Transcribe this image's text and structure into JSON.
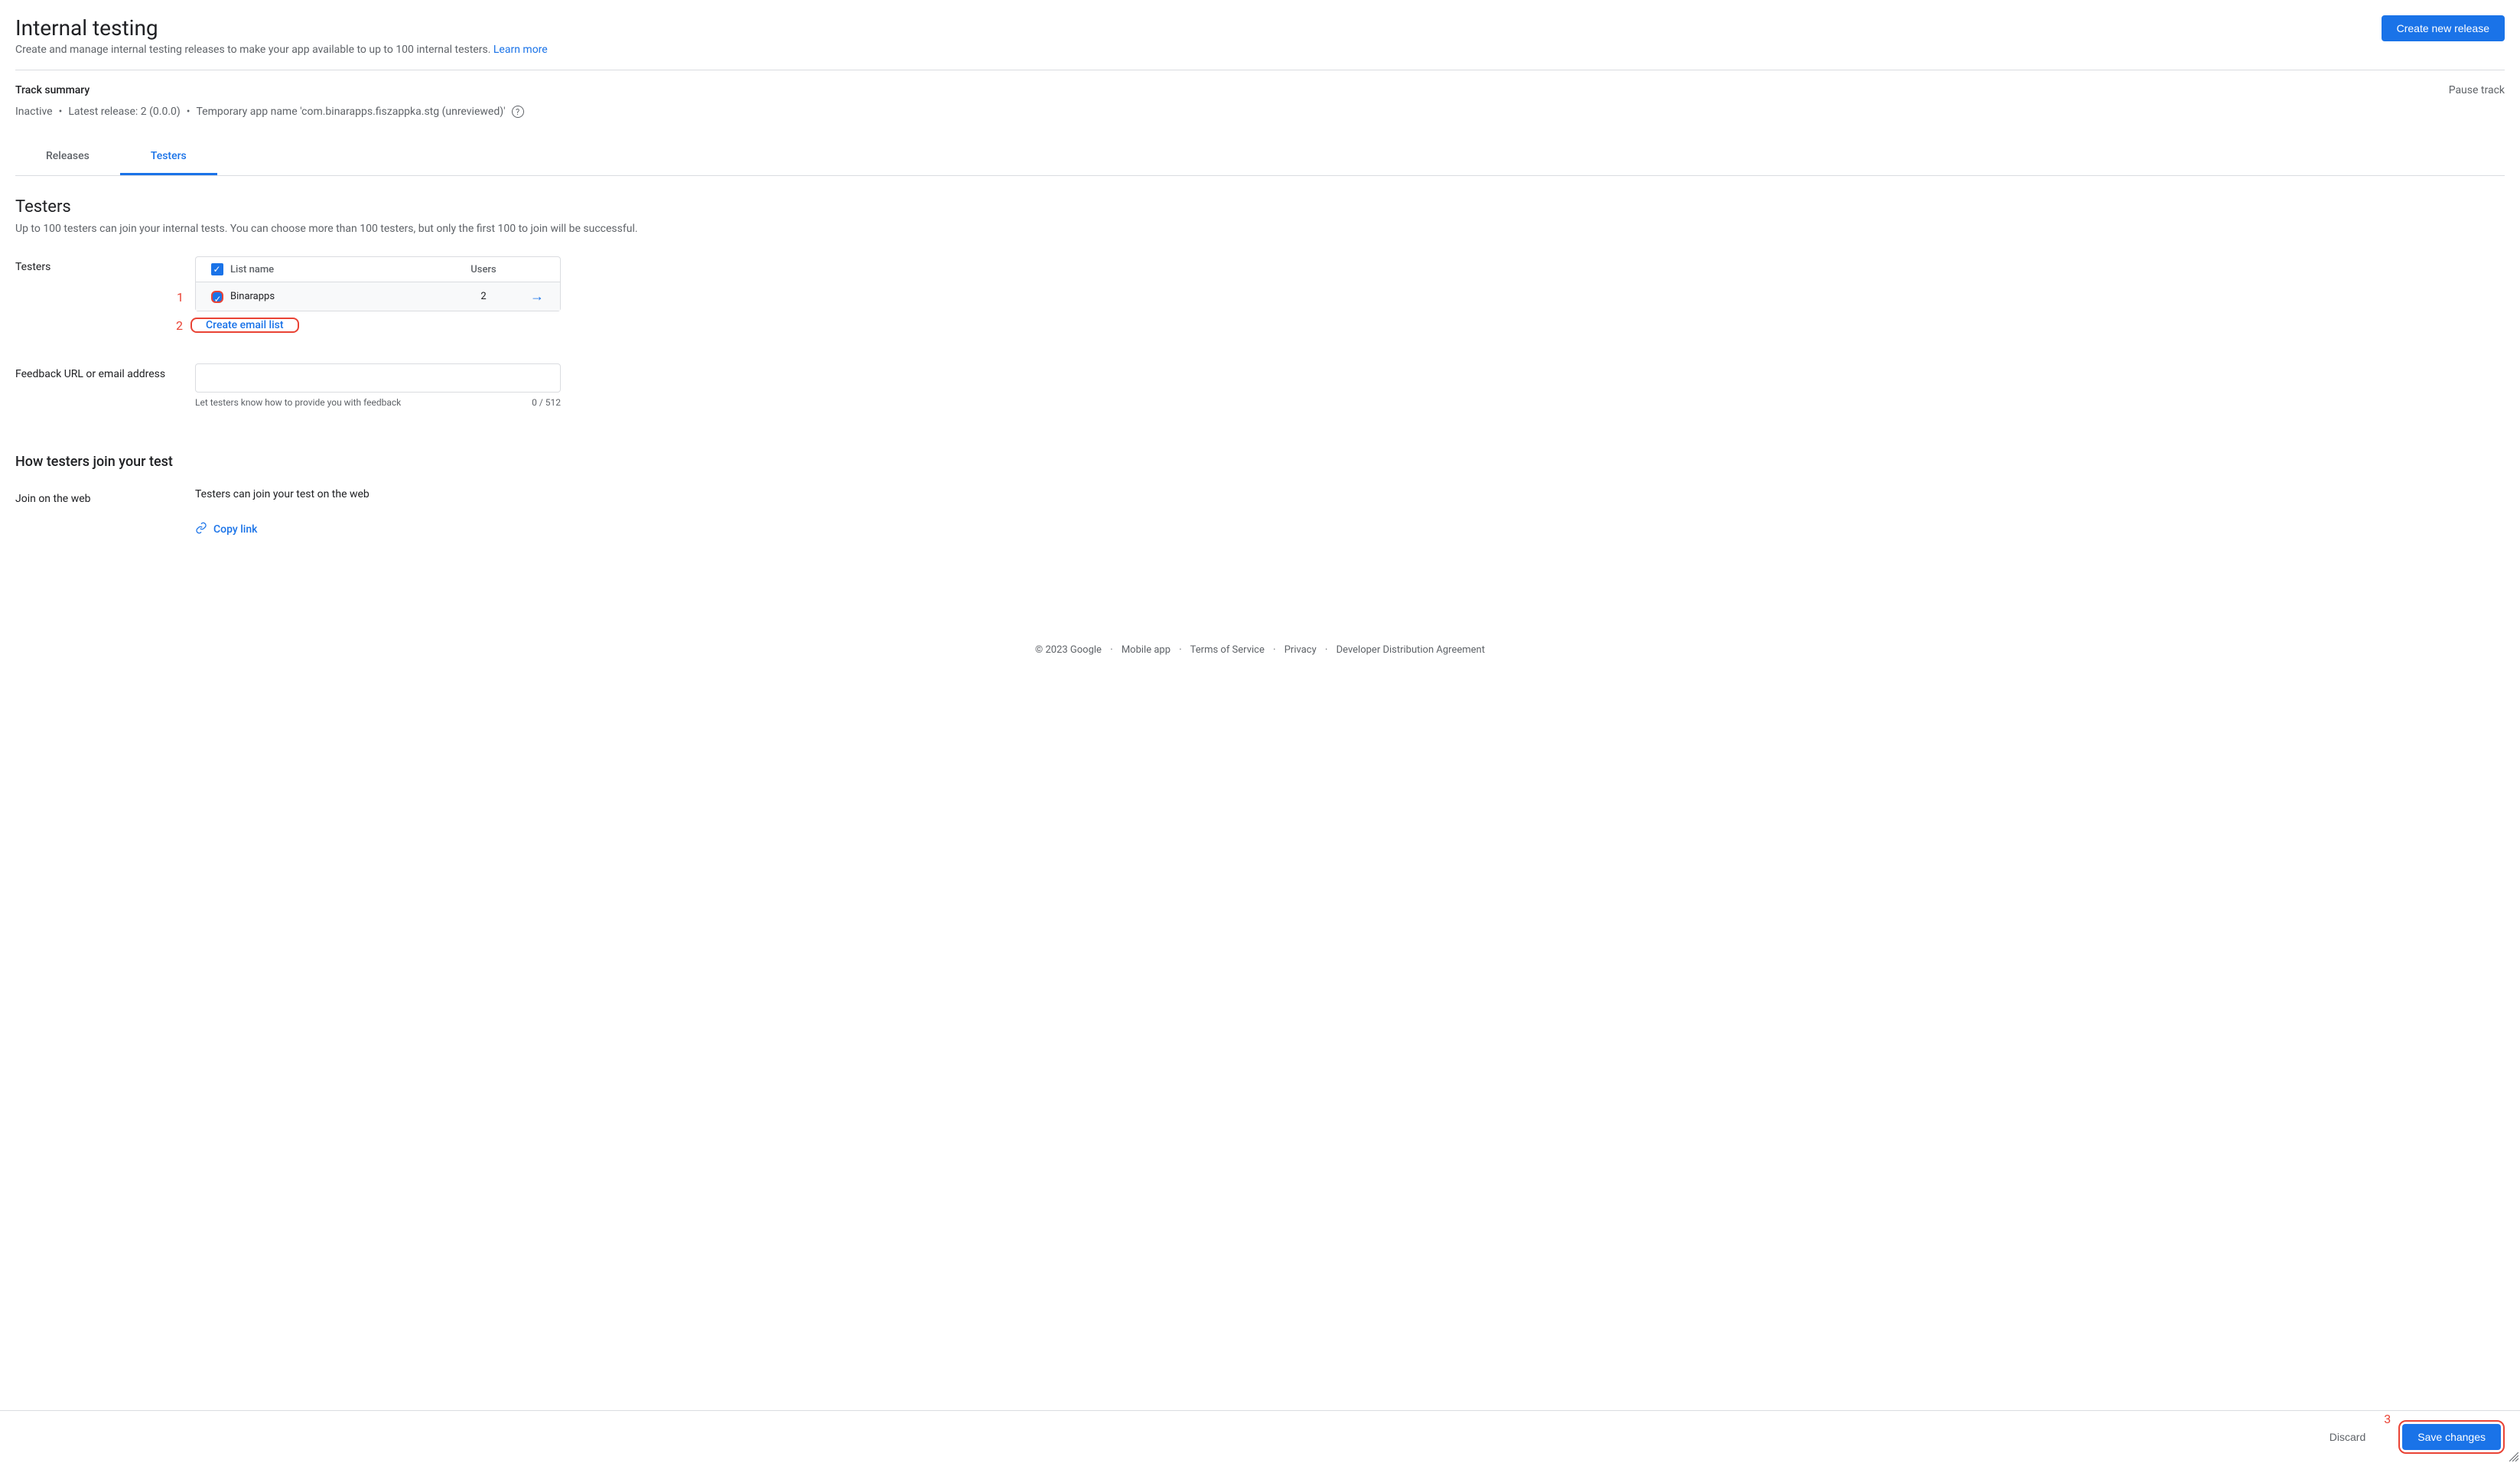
{
  "header": {
    "title": "Internal testing",
    "subtitle": "Create and manage internal testing releases to make your app available to up to 100 internal testers.",
    "learn_more": "Learn more",
    "create_release": "Create new release"
  },
  "track": {
    "summary_label": "Track summary",
    "pause": "Pause track",
    "status": "Inactive",
    "latest": "Latest release: 2 (0.0.0)",
    "temp_name": "Temporary app name 'com.binarapps.fiszappka.stg (unreviewed)'"
  },
  "tabs": {
    "releases": "Releases",
    "testers": "Testers"
  },
  "testers": {
    "heading": "Testers",
    "desc": "Up to 100 testers can join your internal tests. You can choose more than 100 testers, but only the first 100 to join will be successful.",
    "label": "Testers",
    "col_list": "List name",
    "col_users": "Users",
    "row_name": "Binarapps",
    "row_users": "2",
    "create_list": "Create email list",
    "callout1": "1",
    "callout2": "2"
  },
  "feedback": {
    "label": "Feedback URL or email address",
    "hint": "Let testers know how to provide you with feedback",
    "counter": "0 / 512",
    "value": ""
  },
  "join": {
    "heading": "How testers join your test",
    "label": "Join on the web",
    "desc": "Testers can join your test on the web",
    "copy": "Copy link"
  },
  "footer": {
    "copyright": "© 2023 Google",
    "mobile": "Mobile app",
    "terms": "Terms of Service",
    "privacy": "Privacy",
    "dda": "Developer Distribution Agreement"
  },
  "bottom": {
    "discard": "Discard",
    "save": "Save changes",
    "callout3": "3"
  }
}
